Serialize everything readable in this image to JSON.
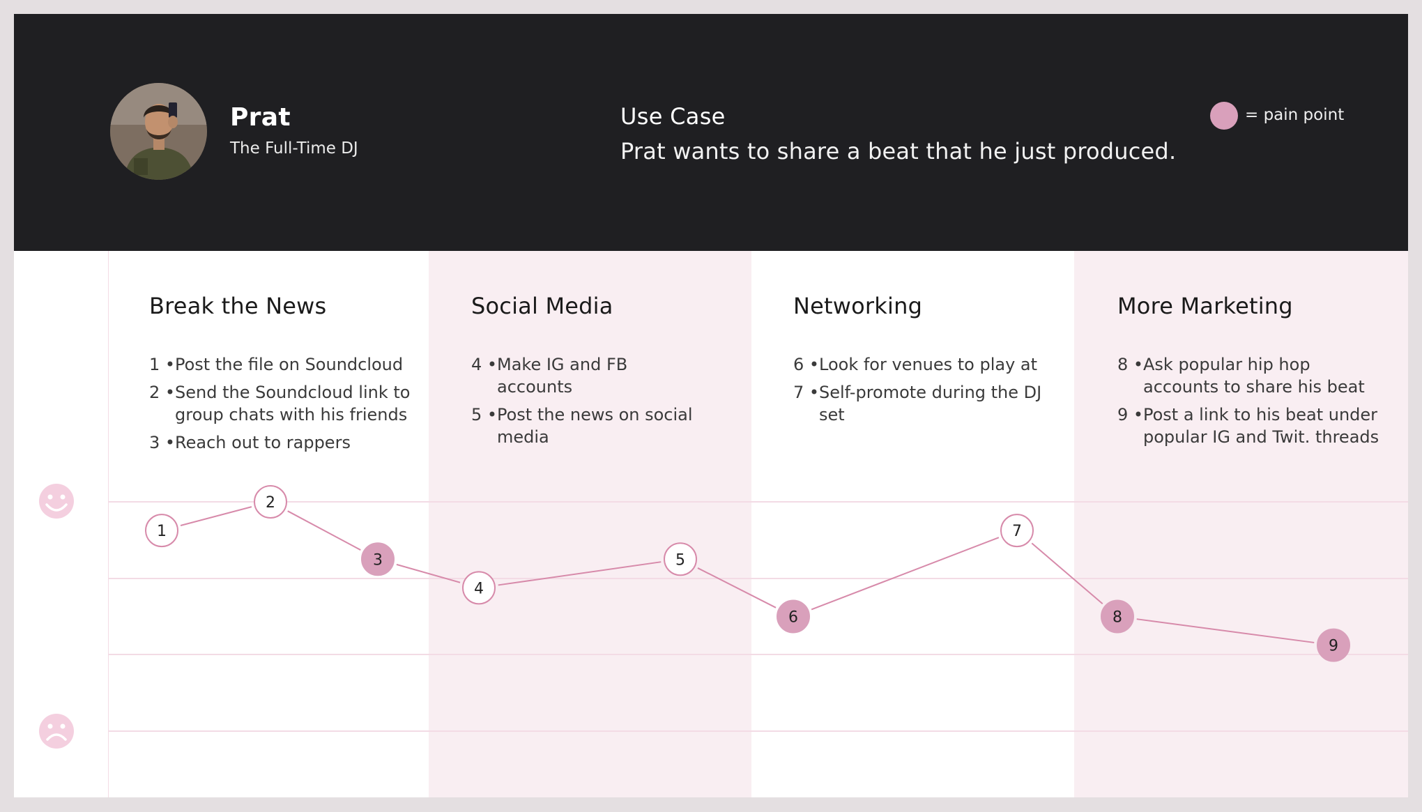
{
  "persona": {
    "name": "Prat",
    "role": "The Full-Time DJ",
    "avatar_icon": "person-photo"
  },
  "use_case": {
    "title": "Use Case",
    "text": "Prat wants to share a beat that he just produced."
  },
  "legend": {
    "label": "= pain point",
    "pain_color": "#d9a0bb"
  },
  "mood_icons": {
    "happy": "happy-face-icon",
    "sad": "sad-face-icon"
  },
  "colors": {
    "header_bg": "#1f1f22",
    "band_pink": "#f9eef2",
    "line": "#d78aaa",
    "node_stroke": "#d78aaa",
    "pain_fill": "#d9a0bb"
  },
  "stages": [
    {
      "title": "Break the News",
      "steps": [
        {
          "num": "1 •",
          "text": "Post the file on Soundcloud"
        },
        {
          "num": "2 •",
          "text": "Send the Soundcloud link to group chats with his friends"
        },
        {
          "num": "3 •",
          "text": "Reach out to rappers"
        }
      ]
    },
    {
      "title": "Social Media",
      "steps": [
        {
          "num": "4 •",
          "text": "Make IG and FB accounts"
        },
        {
          "num": "5 •",
          "text": "Post the news on social media"
        }
      ]
    },
    {
      "title": "Networking",
      "steps": [
        {
          "num": "6 •",
          "text": "Look for venues to play at"
        },
        {
          "num": "7 •",
          "text": "Self-promote during the DJ set"
        }
      ]
    },
    {
      "title": "More Marketing",
      "steps": [
        {
          "num": "8 •",
          "text": "Ask popular hip hop accounts to share his beat"
        },
        {
          "num": "9 •",
          "text": "Post a link to his beat under popular IG and Twit. threads"
        }
      ]
    }
  ],
  "chart_data": {
    "type": "line",
    "title": "",
    "xlabel": "",
    "ylabel": "",
    "y_scale": "emotion: 4 = happy (top gridline) to 0 = sad (bottom gridline)",
    "ylim": [
      0,
      4
    ],
    "points": [
      {
        "label": "1",
        "y": 3.5,
        "pain": false
      },
      {
        "label": "2",
        "y": 4,
        "pain": false
      },
      {
        "label": "3",
        "y": 3,
        "pain": true
      },
      {
        "label": "4",
        "y": 2.5,
        "pain": false
      },
      {
        "label": "5",
        "y": 3,
        "pain": false
      },
      {
        "label": "6",
        "y": 2,
        "pain": true
      },
      {
        "label": "7",
        "y": 3.5,
        "pain": false
      },
      {
        "label": "8",
        "y": 2,
        "pain": true
      },
      {
        "label": "9",
        "y": 1.5,
        "pain": true
      }
    ]
  }
}
